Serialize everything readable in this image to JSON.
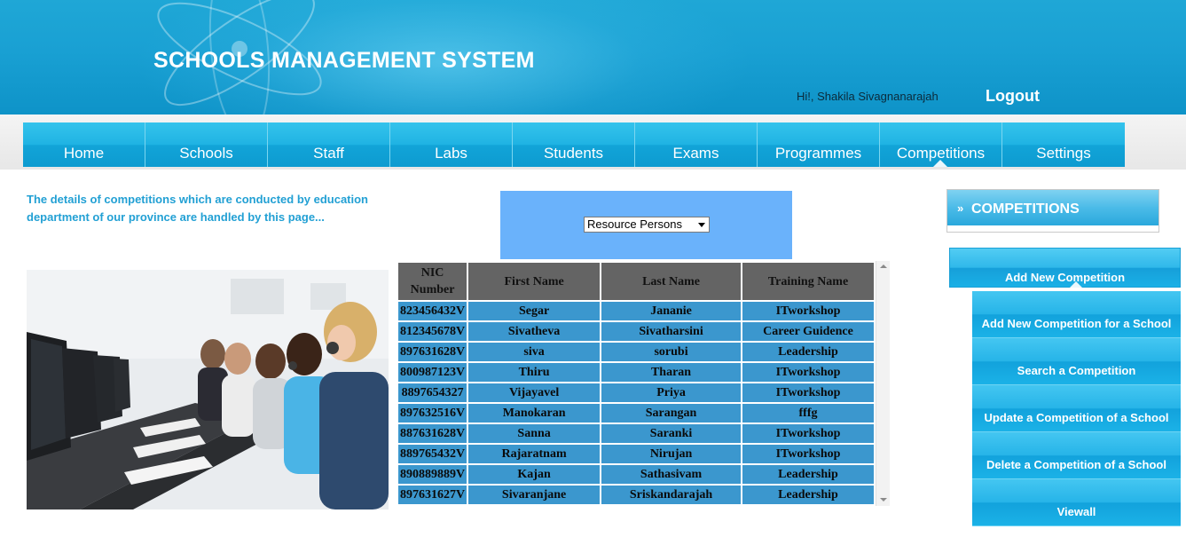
{
  "header": {
    "title": "SCHOOLS MANAGEMENT SYSTEM",
    "greeting": "Hi!, Shakila Sivagnanarajah",
    "logout_label": "Logout"
  },
  "nav": {
    "items": [
      {
        "label": "Home"
      },
      {
        "label": "Schools"
      },
      {
        "label": "Staff"
      },
      {
        "label": "Labs"
      },
      {
        "label": "Students"
      },
      {
        "label": "Exams"
      },
      {
        "label": "Programmes"
      },
      {
        "label": "Competitions"
      },
      {
        "label": "Settings"
      }
    ],
    "active": "Competitions"
  },
  "description": "The details of competitions which are conducted by education department of our province are handled by this page...",
  "filter": {
    "selected": "Resource Persons"
  },
  "table": {
    "columns": [
      "NIC Number",
      "First Name",
      "Last Name",
      "Training Name"
    ],
    "rows": [
      [
        "823456432V",
        "Segar",
        "Jananie",
        "ITworkshop"
      ],
      [
        "812345678V",
        "Sivatheva",
        "Sivatharsini",
        "Career Guidence"
      ],
      [
        "897631628V",
        "siva",
        "sorubi",
        "Leadership"
      ],
      [
        "800987123V",
        "Thiru",
        "Tharan",
        "ITworkshop"
      ],
      [
        "8897654327",
        "Vijayavel",
        "Priya",
        "ITworkshop"
      ],
      [
        "897632516V",
        "Manokaran",
        "Sarangan",
        "fffg"
      ],
      [
        "887631628V",
        "Sanna",
        "Saranki",
        "ITworkshop"
      ],
      [
        "889765432V",
        "Rajaratnam",
        "Nirujan",
        "ITworkshop"
      ],
      [
        "890889889V",
        "Kajan",
        "Sathasivam",
        "Leadership"
      ],
      [
        "897631627V",
        "Sivaranjane",
        "Sriskandarajah",
        "Leadership"
      ]
    ]
  },
  "sidebar": {
    "heading": "COMPETITIONS",
    "main_item": "Add New Competition",
    "sub_items": [
      {
        "label": "Add New Competition for a School"
      },
      {
        "label": "Search a Competition"
      },
      {
        "label": "Update a Competition of a School"
      },
      {
        "label": "Delete a Competition of a School"
      },
      {
        "label": "Viewall"
      }
    ]
  },
  "colors": {
    "header_blue": "#1fa7d6",
    "nav_blue": "#1fb3e3",
    "filter_box": "#6ab2fb",
    "table_header": "#646464",
    "table_cell": "#3b97ce",
    "description_text": "#22a0d4"
  }
}
